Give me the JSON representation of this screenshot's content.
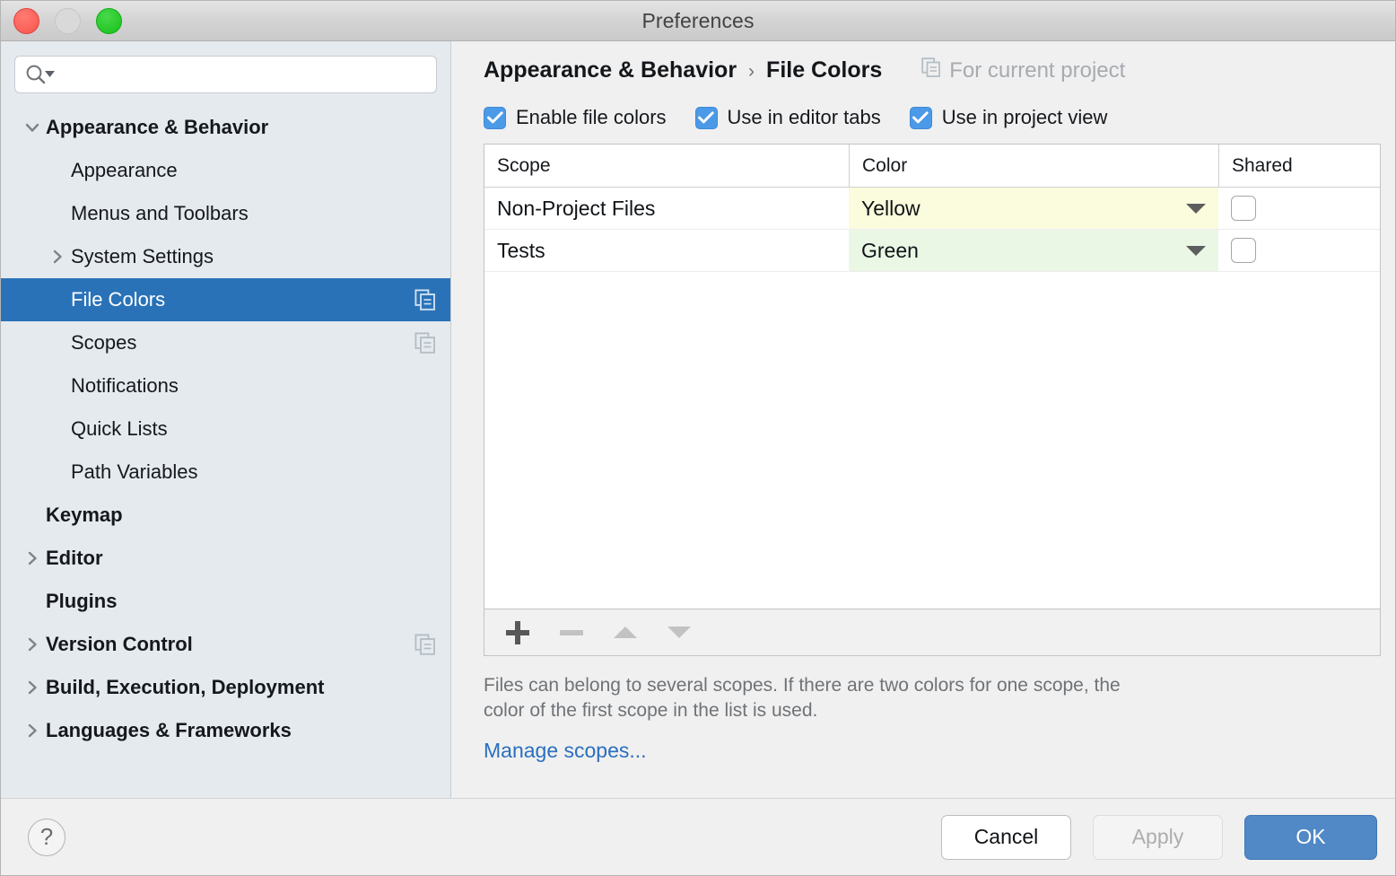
{
  "window": {
    "title": "Preferences",
    "traffic_lights": [
      "close-button",
      "minimize-button",
      "maximize-button"
    ]
  },
  "sidebar": {
    "search": {
      "value": "",
      "placeholder": "",
      "icon": "search-icon",
      "dropdown_icon": "chevron-down-icon"
    },
    "items": [
      {
        "label": "Appearance & Behavior",
        "depth": 0,
        "twisty": "expanded",
        "selected": false,
        "icon": null
      },
      {
        "label": "Appearance",
        "depth": 1,
        "twisty": "none",
        "selected": false,
        "icon": null
      },
      {
        "label": "Menus and Toolbars",
        "depth": 1,
        "twisty": "none",
        "selected": false,
        "icon": null
      },
      {
        "label": "System Settings",
        "depth": 1,
        "twisty": "collapsed",
        "selected": false,
        "icon": null
      },
      {
        "label": "File Colors",
        "depth": 1,
        "twisty": "none",
        "selected": true,
        "icon": "copy-icon"
      },
      {
        "label": "Scopes",
        "depth": 1,
        "twisty": "none",
        "selected": false,
        "icon": "copy-icon"
      },
      {
        "label": "Notifications",
        "depth": 1,
        "twisty": "none",
        "selected": false,
        "icon": null
      },
      {
        "label": "Quick Lists",
        "depth": 1,
        "twisty": "none",
        "selected": false,
        "icon": null
      },
      {
        "label": "Path Variables",
        "depth": 1,
        "twisty": "none",
        "selected": false,
        "icon": null
      },
      {
        "label": "Keymap",
        "depth": 0,
        "twisty": "none",
        "selected": false,
        "icon": null
      },
      {
        "label": "Editor",
        "depth": 0,
        "twisty": "collapsed",
        "selected": false,
        "icon": null
      },
      {
        "label": "Plugins",
        "depth": 0,
        "twisty": "none",
        "selected": false,
        "icon": null
      },
      {
        "label": "Version Control",
        "depth": 0,
        "twisty": "collapsed",
        "selected": false,
        "icon": "copy-icon"
      },
      {
        "label": "Build, Execution, Deployment",
        "depth": 0,
        "twisty": "collapsed",
        "selected": false,
        "icon": null
      },
      {
        "label": "Languages & Frameworks",
        "depth": 0,
        "twisty": "collapsed",
        "selected": false,
        "icon": null
      }
    ]
  },
  "content": {
    "breadcrumb": {
      "parent": "Appearance & Behavior",
      "separator": "›",
      "current": "File Colors"
    },
    "for_current_project": {
      "label": "For current project",
      "icon": "copy-icon"
    },
    "options": [
      {
        "label": "Enable file colors",
        "checked": true
      },
      {
        "label": "Use in editor tabs",
        "checked": true
      },
      {
        "label": "Use in project view",
        "checked": true
      }
    ],
    "table": {
      "columns": [
        "Scope",
        "Color",
        "Shared"
      ],
      "rows": [
        {
          "scope": "Non-Project Files",
          "color": "Yellow",
          "color_swatch": "#fbfbdd",
          "shared": false
        },
        {
          "scope": "Tests",
          "color": "Green",
          "color_swatch": "#eaf7e5",
          "shared": false
        }
      ]
    },
    "table_toolbar": [
      {
        "name": "add-button",
        "icon": "plus-icon",
        "enabled": true
      },
      {
        "name": "remove-button",
        "icon": "minus-icon",
        "enabled": false
      },
      {
        "name": "move-up-button",
        "icon": "arrow-up-icon",
        "enabled": false
      },
      {
        "name": "move-down-button",
        "icon": "arrow-down-icon",
        "enabled": false
      }
    ],
    "hint": "Files can belong to several scopes. If there are two colors for one scope, the color of the first scope in the list is used.",
    "manage_scopes_link": "Manage scopes..."
  },
  "footer": {
    "help": "?",
    "cancel": "Cancel",
    "apply": "Apply",
    "ok": "OK"
  },
  "colors": {
    "accent_blue": "#2a72b8",
    "checkbox_blue": "#4b9ae8",
    "primary_button": "#5189c6",
    "link": "#2a6fbf",
    "sidebar_bg": "#e5eaee",
    "panel_bg": "#f0f0f0",
    "yellow_row": "#fbfbdd",
    "green_row": "#eaf7e5"
  }
}
